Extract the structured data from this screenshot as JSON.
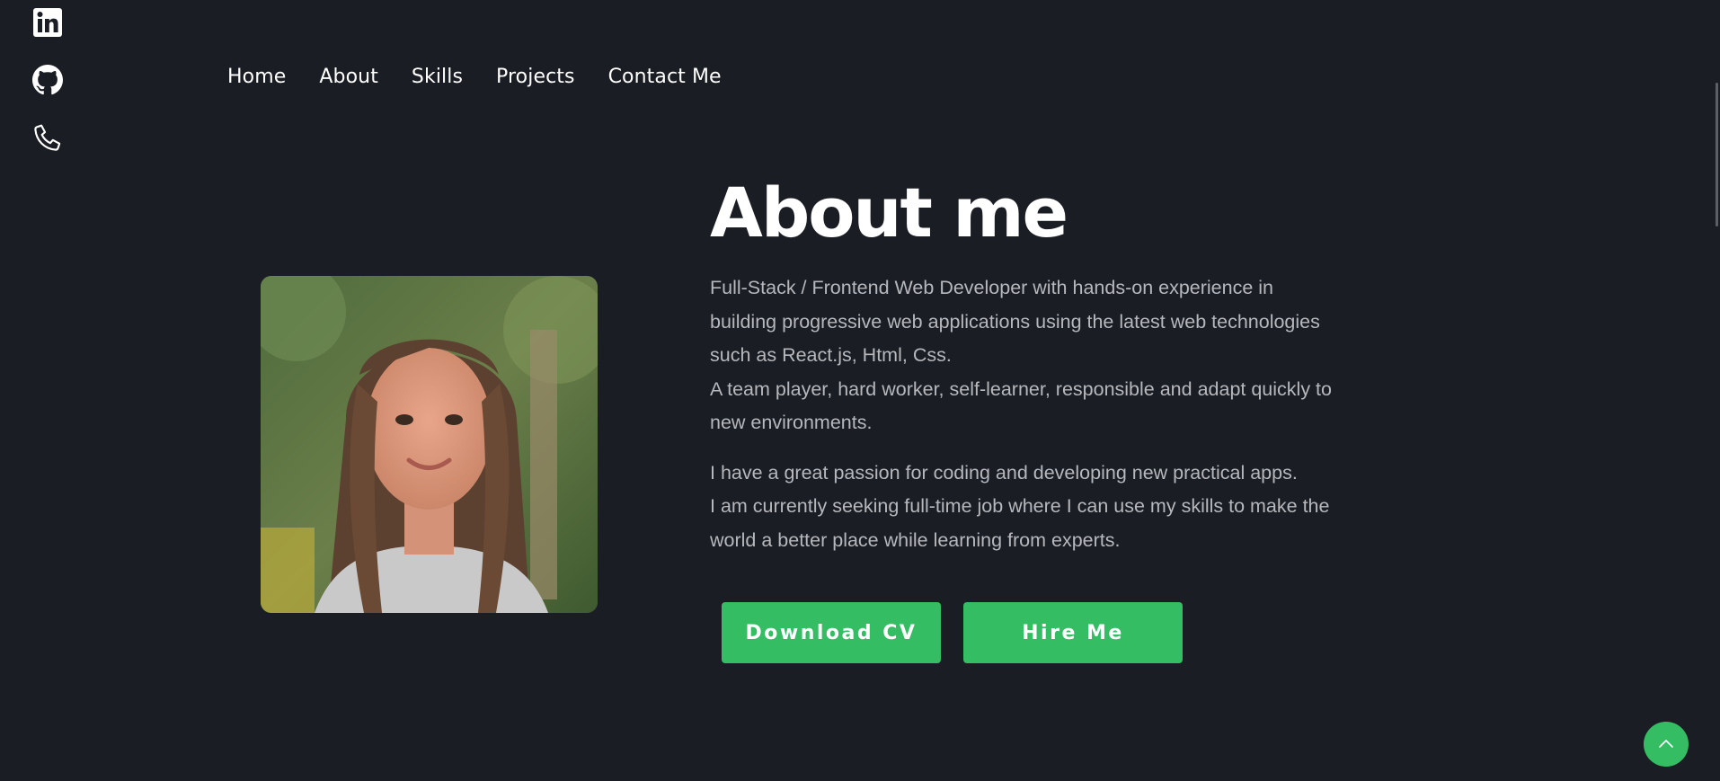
{
  "social": [
    {
      "icon": "linkedin-icon"
    },
    {
      "icon": "github-icon"
    },
    {
      "icon": "phone-icon"
    }
  ],
  "nav": {
    "items": [
      "Home",
      "About",
      "Skills",
      "Projects",
      "Contact Me"
    ]
  },
  "about": {
    "title": "About me",
    "paragraph1": [
      "Full-Stack / Frontend Web Developer with hands-on experience in",
      "building progressive web applications using the latest web technologies",
      "such as React.js, Html, Css.",
      "A team player, hard worker, self-learner, responsible and adapt quickly to",
      "new environments."
    ],
    "paragraph2": [
      "I have a great passion for coding and developing new practical apps.",
      "I am currently seeking full-time job where I can use my skills to make the",
      "world a better place while learning from experts."
    ],
    "photo": "profile-photo"
  },
  "buttons": {
    "download_cv": "Download CV",
    "hire_me": "Hire Me"
  },
  "colors": {
    "background": "#1a1d24",
    "accent": "#34bd63",
    "text": "#ffffff",
    "muted_text": "#b6b8bd"
  },
  "scroll_top": {
    "icon": "chevron-up-icon"
  }
}
